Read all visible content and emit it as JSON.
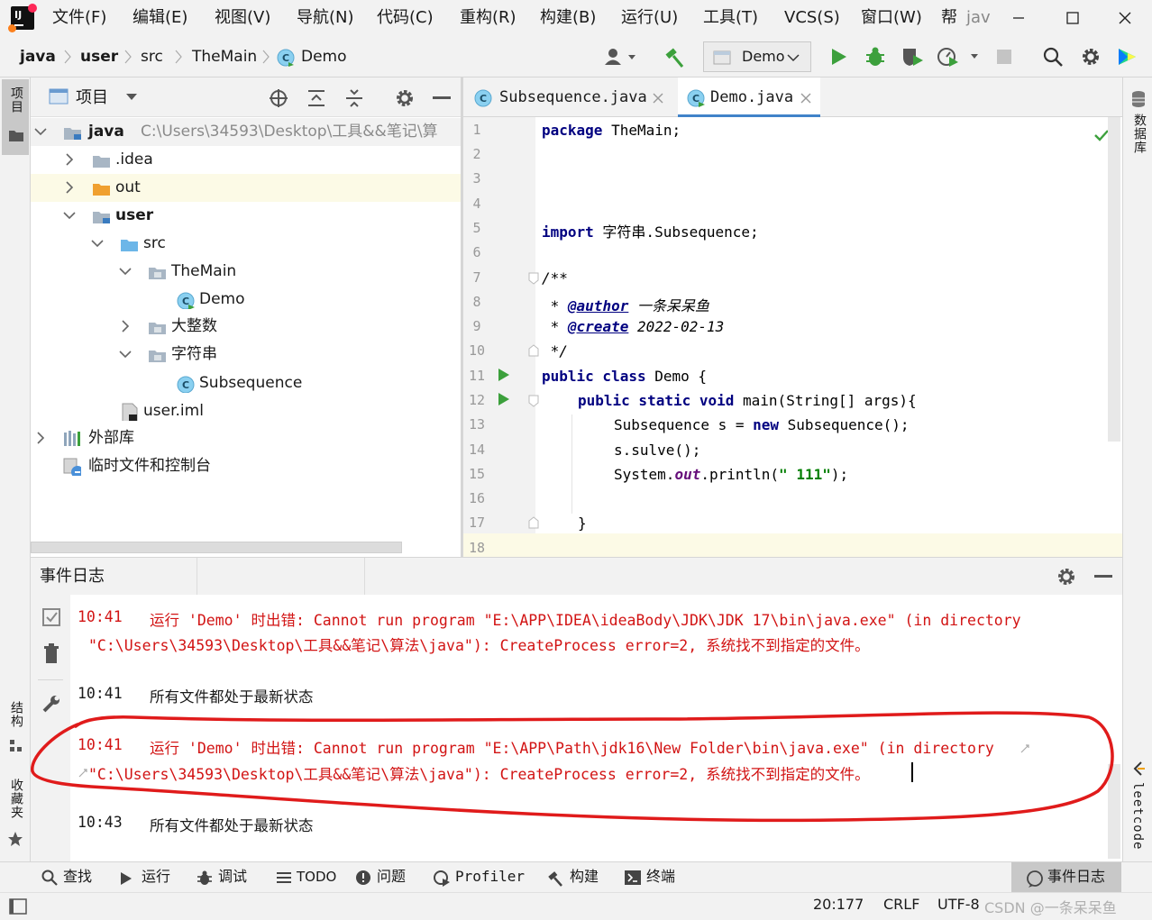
{
  "menu": {
    "items": [
      "文件(F)",
      "编辑(E)",
      "视图(V)",
      "导航(N)",
      "代码(C)",
      "重构(R)",
      "构建(B)",
      "运行(U)",
      "工具(T)",
      "VCS(S)",
      "窗口(W)",
      "帮"
    ],
    "window_title_fragment": "jav"
  },
  "breadcrumb": [
    "java",
    "user",
    "src",
    "TheMain",
    "Demo"
  ],
  "run_config": {
    "selected": "Demo"
  },
  "left_stripe": {
    "project": "项目",
    "structure": "结构",
    "favorites": "收藏夹"
  },
  "right_stripe": {
    "database": "数据库",
    "leetcode": "leetcode"
  },
  "project_panel": {
    "title": "项目",
    "tree": [
      {
        "label": "java",
        "path": "C:\\Users\\34593\\Desktop\\工具&&笔记\\算"
      },
      {
        "label": ".idea"
      },
      {
        "label": "out"
      },
      {
        "label": "user"
      },
      {
        "label": "src"
      },
      {
        "label": "TheMain"
      },
      {
        "label": "Demo"
      },
      {
        "label": "大整数"
      },
      {
        "label": "字符串"
      },
      {
        "label": "Subsequence"
      },
      {
        "label": "user.iml"
      },
      {
        "label": "外部库"
      },
      {
        "label": "临时文件和控制台"
      }
    ]
  },
  "editor": {
    "tabs": [
      "Subsequence.java",
      "Demo.java"
    ],
    "active_tab": "Demo.java",
    "line_numbers": [
      "1",
      "2",
      "3",
      "4",
      "5",
      "6",
      "7",
      "8",
      "9",
      "10",
      "11",
      "12",
      "13",
      "14",
      "15",
      "16",
      "17",
      "18"
    ],
    "code": {
      "l1_kw": "package",
      "l1_rest": " TheMain;",
      "l5_kw": "import",
      "l5_rest": " 字符串.Subsequence;",
      "l7": "/**",
      "l8_star": " * ",
      "l8_tag": "@author",
      "l8_val": " 一条呆呆鱼",
      "l9_star": " * ",
      "l9_tag": "@create",
      "l9_val": " 2022-02-13",
      "l10": " */",
      "l11_kw": "public class",
      "l11_rest": " Demo {",
      "l12_kw": "public static void",
      "l12_rest": " main(String[] args){",
      "l13_a": "Subsequence s = ",
      "l13_kw": "new",
      "l13_b": " Subsequence();",
      "l14": "s.sulve();",
      "l15_a": "System.",
      "l15_fld": "out",
      "l15_b": ".println(",
      "l15_str": "\" 111\"",
      "l15_c": ");",
      "l17": "}"
    }
  },
  "event_log": {
    "title": "事件日志",
    "entries": [
      {
        "time": "10:41",
        "line1": "运行 'Demo' 时出错: Cannot run program \"E:\\APP\\IDEA\\ideaBody\\JDK\\JDK 17\\bin\\java.exe\" (in directory",
        "line2": "\"C:\\Users\\34593\\Desktop\\工具&&笔记\\算法\\java\"): CreateProcess error=2, 系统找不到指定的文件。"
      },
      {
        "time": "10:41",
        "line1": "所有文件都处于最新状态"
      },
      {
        "time": "10:41",
        "line1": "运行 'Demo' 时出错: Cannot run program \"E:\\APP\\Path\\jdk16\\New Folder\\bin\\java.exe\" (in directory",
        "line2": "\"C:\\Users\\34593\\Desktop\\工具&&笔记\\算法\\java\"): CreateProcess error=2, 系统找不到指定的文件。"
      },
      {
        "time": "10:43",
        "line1": "所有文件都处于最新状态"
      }
    ]
  },
  "bottom_toolbar": [
    "查找",
    "运行",
    "调试",
    "TODO",
    "问题",
    "Profiler",
    "构建",
    "终端",
    "事件日志"
  ],
  "status_bar": {
    "position": "20:177",
    "line_sep": "CRLF",
    "encoding": "UTF-8",
    "watermark": "CSDN @一条呆呆鱼"
  },
  "colors": {
    "error_text": "#d21414",
    "annotation_circle": "#e01b1b",
    "keyword": "#000080",
    "run_green": "#3ca03c"
  }
}
